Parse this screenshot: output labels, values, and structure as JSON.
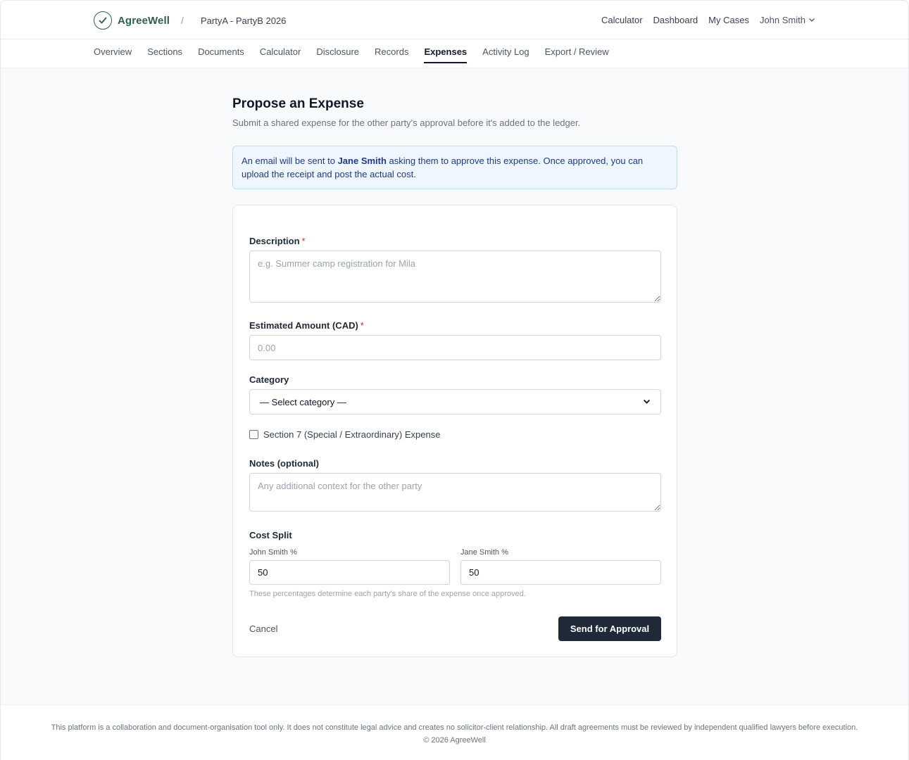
{
  "app": {
    "brand_name": "AgreeWell",
    "breadcrumb_separator": "/",
    "case_name": "PartyA - PartyB 2026",
    "logo_icon": "check-circle-icon"
  },
  "topnav": {
    "calculator": "Calculator",
    "dashboard": "Dashboard",
    "my_cases": "My Cases",
    "user_name": "John Smith"
  },
  "subnav": {
    "items": [
      {
        "label": "Overview"
      },
      {
        "label": "Sections"
      },
      {
        "label": "Documents"
      },
      {
        "label": "Calculator"
      },
      {
        "label": "Disclosure"
      },
      {
        "label": "Records"
      },
      {
        "label": "Expenses",
        "active": true
      },
      {
        "label": "Activity Log"
      },
      {
        "label": "Export / Review"
      }
    ]
  },
  "page": {
    "title": "Propose an Expense",
    "subtitle": "Submit a shared expense for the other party's approval before it's added to the ledger."
  },
  "info": {
    "prefix": "An email will be sent to ",
    "name": "Jane Smith",
    "suffix": " asking them to approve this expense. Once approved, you can upload the receipt and post the actual cost."
  },
  "form": {
    "description": {
      "label": "Description",
      "required_mark": "*",
      "placeholder": "e.g. Summer camp registration for Mila"
    },
    "amount": {
      "label": "Estimated Amount (CAD)",
      "required_mark": "*",
      "placeholder": "0.00"
    },
    "category": {
      "label": "Category",
      "selected": "— Select category —"
    },
    "section7": {
      "label": "Section 7 (Special / Extraordinary) Expense"
    },
    "notes": {
      "label": "Notes (optional)",
      "placeholder": "Any additional context for the other party"
    },
    "split": {
      "label": "Cost Split",
      "party_a_label": "John Smith %",
      "party_a_value": "50",
      "party_b_label": "Jane Smith %",
      "party_b_value": "50",
      "help": "These percentages determine each party's share of the expense once approved."
    },
    "cancel_label": "Cancel",
    "submit_label": "Send for Approval"
  },
  "footer": {
    "disclaimer": "This platform is a collaboration and document-organisation tool only. It does not constitute legal advice and creates no solicitor-client relationship. All draft agreements must be reviewed by independent qualified lawyers before execution.",
    "copyright": "© 2026 AgreeWell"
  },
  "colors": {
    "brand": "#2f5d50",
    "primary_button": "#1f2937",
    "info_bg": "#eff6ff",
    "info_text": "#1e3a8a",
    "required": "#dc2626"
  }
}
